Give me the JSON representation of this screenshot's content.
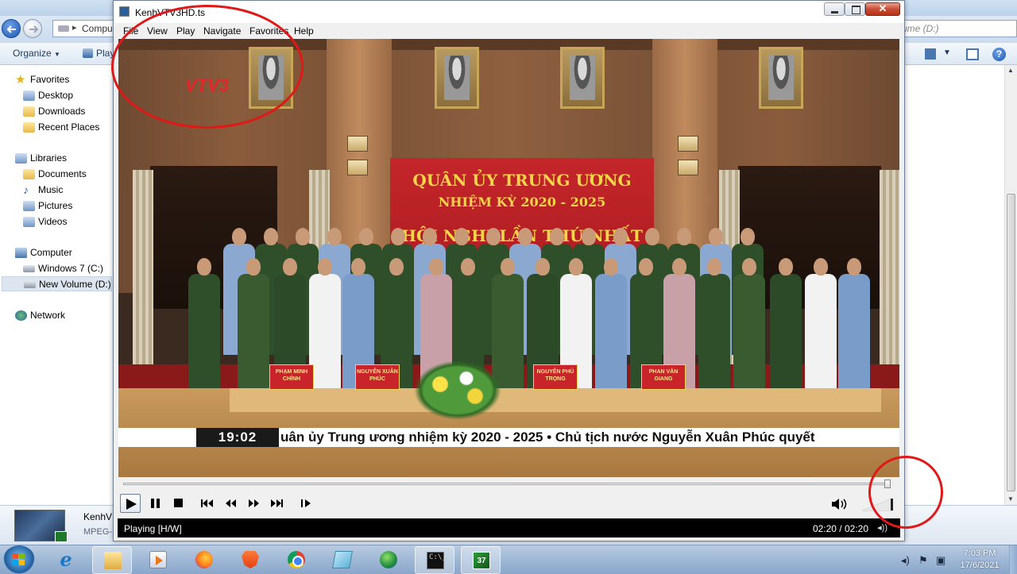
{
  "explorer": {
    "address_text": "Compu",
    "search_placeholder": "ume (D:)",
    "toolbar": {
      "organize": "Organize",
      "organize_arrow": "▼",
      "play": "Play",
      "views_arrow": "▼",
      "help": "?"
    },
    "nav": {
      "favorites": "Favorites",
      "desktop": "Desktop",
      "downloads": "Downloads",
      "recent_places": "Recent Places",
      "libraries": "Libraries",
      "documents": "Documents",
      "music": "Music",
      "pictures": "Pictures",
      "videos": "Videos",
      "computer": "Computer",
      "windows7": "Windows 7 (C:)",
      "new_volume": "New Volume (D:)",
      "network": "Network"
    },
    "details": {
      "file_name": "KenhV",
      "file_type": "MPEG-"
    }
  },
  "player": {
    "window_title": "KenhVTV3HD.ts",
    "menu": [
      "File",
      "View",
      "Play",
      "Navigate",
      "Favorites",
      "Help"
    ],
    "video": {
      "channel_logo_letters": "VTV",
      "channel_logo_number": "3",
      "banner_line1": "QUÂN ỦY TRUNG ƯƠNG",
      "banner_line2": "NHIỆM KỲ 2020 - 2025",
      "banner_line3": "HỘI NGHỊ LẦN THỨ NHẤT",
      "ticker_clock": "19:02",
      "ticker_text": "uân ủy Trung ương nhiệm kỳ 2020 - 2025   •   Chủ tịch nước Nguyễn Xuân Phúc quyết",
      "nameplates": [
        "PHẠM MINH CHÍNH",
        "NGUYỄN XUÂN PHÚC",
        "NGUYỄN PHÚ TRỌNG",
        "PHAN VĂN GIANG"
      ]
    },
    "seek_position": 1.0,
    "volume_level": 1.0,
    "status": {
      "state": "Playing [H/W]",
      "time": "02:20 / 02:20"
    }
  },
  "taskbar": {
    "clock_time": "7:03 PM",
    "clock_date": "17/6/2021",
    "apps": [
      "internet-explorer",
      "windows-explorer",
      "windows-media-player",
      "firefox",
      "brave",
      "chrome",
      "notepad",
      "browser-globe",
      "command-prompt",
      "media-player-classic"
    ]
  },
  "colors": {
    "annotation_red": "#e01818",
    "banner_red": "#b01e22",
    "banner_text": "#f6d54a"
  }
}
